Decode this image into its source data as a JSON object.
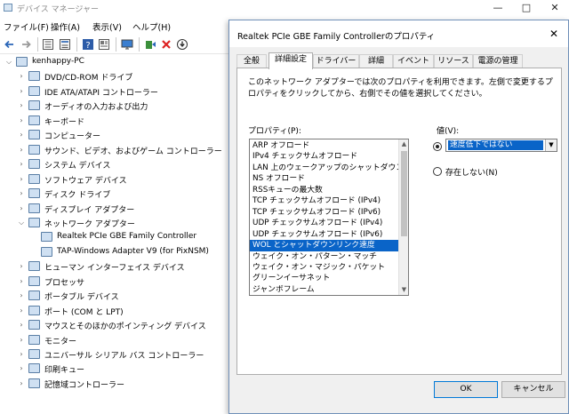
{
  "device_manager": {
    "title": "デバイス マネージャー",
    "controls": {
      "minimize": "—",
      "maximize": "□",
      "close": "✕"
    },
    "menu": [
      "ファイル(F)",
      "操作(A)",
      "表示(V)",
      "ヘルプ(H)"
    ],
    "toolbar_icons": [
      "back-arrow-icon",
      "forward-arrow-icon",
      "tree-view-icon",
      "properties-icon",
      "help-icon",
      "show-hidden-icon",
      "monitor-icon",
      "update-driver-icon",
      "uninstall-icon",
      "scan-hardware-icon"
    ],
    "tree": {
      "root": "kenhappy-PC",
      "items": [
        {
          "label": "DVD/CD-ROM ドライブ",
          "expanded": false
        },
        {
          "label": "IDE ATA/ATAPI コントローラー",
          "expanded": false
        },
        {
          "label": "オーディオの入力および出力",
          "expanded": false
        },
        {
          "label": "キーボード",
          "expanded": false
        },
        {
          "label": "コンピューター",
          "expanded": false
        },
        {
          "label": "サウンド、ビデオ、およびゲーム コントローラー",
          "expanded": false
        },
        {
          "label": "システム デバイス",
          "expanded": false
        },
        {
          "label": "ソフトウェア デバイス",
          "expanded": false
        },
        {
          "label": "ディスク ドライブ",
          "expanded": false
        },
        {
          "label": "ディスプレイ アダプター",
          "expanded": false
        },
        {
          "label": "ネットワーク アダプター",
          "expanded": true,
          "children": [
            "Realtek PCIe GBE Family Controller",
            "TAP-Windows Adapter V9 (for PixNSM)"
          ]
        },
        {
          "label": "ヒューマン インターフェイス デバイス",
          "expanded": false
        },
        {
          "label": "プロセッサ",
          "expanded": false
        },
        {
          "label": "ポータブル デバイス",
          "expanded": false
        },
        {
          "label": "ポート (COM と LPT)",
          "expanded": false
        },
        {
          "label": "マウスとそのほかのポインティング デバイス",
          "expanded": false
        },
        {
          "label": "モニター",
          "expanded": false
        },
        {
          "label": "ユニバーサル シリアル バス コントローラー",
          "expanded": false
        },
        {
          "label": "印刷キュー",
          "expanded": false
        },
        {
          "label": "記憶域コントローラー",
          "expanded": false
        }
      ]
    }
  },
  "dialog": {
    "title": "Realtek PCIe GBE Family Controllerのプロパティ",
    "close": "✕",
    "tabs": [
      "全般",
      "詳細設定",
      "ドライバー",
      "詳細",
      "イベント",
      "リソース",
      "電源の管理"
    ],
    "active_tab": 1,
    "description": "このネットワーク アダプターでは次のプロパティを利用できます。左側で変更するプロパティをクリックしてから、右側でその値を選択してください。",
    "property_label": "プロパティ(P):",
    "value_label": "値(V):",
    "properties": [
      "ARP オフロード",
      "IPv4 チェックサムオフロード",
      "LAN 上のウェークアップのシャットダウン",
      "NS オフロード",
      "RSSキューの最大数",
      "TCP チェックサムオフロード (IPv4)",
      "TCP チェックサムオフロード (IPv6)",
      "UDP チェックサムオフロード (IPv4)",
      "UDP チェックサムオフロード (IPv6)",
      "WOL とシャットダウンリンク速度",
      "ウェイク・オン・パターン・マッチ",
      "ウェイク・オン・マジック・パケット",
      "グリーンイーサネット",
      "ジャンボフレーム"
    ],
    "selected_property": 9,
    "value_selected": "速度低下ではない",
    "not_present_label": "存在しない(N)",
    "ok_label": "OK",
    "cancel_label": "キャンセル"
  }
}
